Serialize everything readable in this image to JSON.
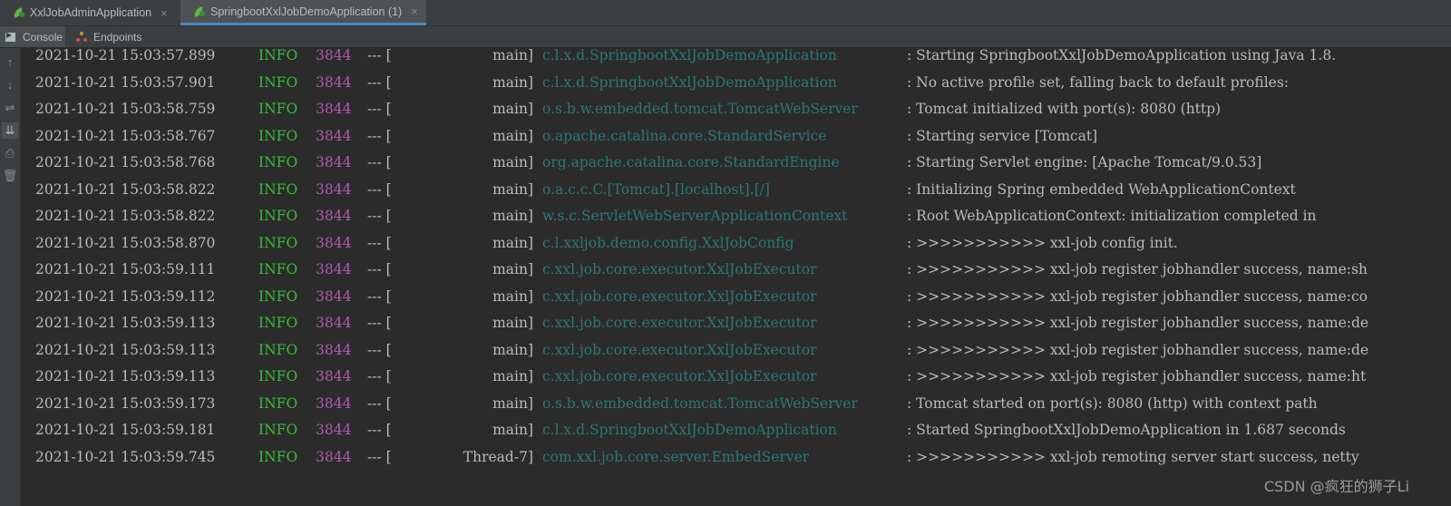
{
  "run_tabs": [
    {
      "label": "XxlJobAdminApplication",
      "icon": "spring-boot-icon",
      "close": "×"
    },
    {
      "label": "SpringbootXxlJobDemoApplication (1)",
      "icon": "spring-boot-icon",
      "close": "×"
    }
  ],
  "sub_tabs": [
    {
      "label": "Console",
      "icon": "console-icon"
    },
    {
      "label": "Endpoints",
      "icon": "endpoints-icon"
    }
  ],
  "toolbar": [
    {
      "icon": "arrow-up-icon",
      "glyph": "↑"
    },
    {
      "icon": "arrow-down-icon",
      "glyph": "↓"
    },
    {
      "icon": "soft-wrap-icon",
      "glyph": "⇌"
    },
    {
      "icon": "scroll-to-end-icon",
      "glyph": "⇊"
    },
    {
      "icon": "print-icon",
      "glyph": "⎙"
    },
    {
      "icon": "trash-icon",
      "glyph": "🗑"
    }
  ],
  "log_lines": [
    {
      "date": "2021-10-21 15:03:57.899",
      "level": "INFO",
      "pid": "3844",
      "sep": "--- [",
      "thread": "main]",
      "logger": "c.l.x.d.SpringbootXxlJobDemoApplication",
      "message": ": Starting SpringbootXxlJobDemoApplication using Java 1.8."
    },
    {
      "date": "2021-10-21 15:03:57.901",
      "level": "INFO",
      "pid": "3844",
      "sep": "--- [",
      "thread": "main]",
      "logger": "c.l.x.d.SpringbootXxlJobDemoApplication",
      "message": ": No active profile set, falling back to default profiles:"
    },
    {
      "date": "2021-10-21 15:03:58.759",
      "level": "INFO",
      "pid": "3844",
      "sep": "--- [",
      "thread": "main]",
      "logger": "o.s.b.w.embedded.tomcat.TomcatWebServer",
      "message": ": Tomcat initialized with port(s): 8080 (http)"
    },
    {
      "date": "2021-10-21 15:03:58.767",
      "level": "INFO",
      "pid": "3844",
      "sep": "--- [",
      "thread": "main]",
      "logger": "o.apache.catalina.core.StandardService",
      "message": ": Starting service [Tomcat]"
    },
    {
      "date": "2021-10-21 15:03:58.768",
      "level": "INFO",
      "pid": "3844",
      "sep": "--- [",
      "thread": "main]",
      "logger": "org.apache.catalina.core.StandardEngine",
      "message": ": Starting Servlet engine: [Apache Tomcat/9.0.53]"
    },
    {
      "date": "2021-10-21 15:03:58.822",
      "level": "INFO",
      "pid": "3844",
      "sep": "--- [",
      "thread": "main]",
      "logger": "o.a.c.c.C.[Tomcat].[localhost].[/]",
      "message": ": Initializing Spring embedded WebApplicationContext"
    },
    {
      "date": "2021-10-21 15:03:58.822",
      "level": "INFO",
      "pid": "3844",
      "sep": "--- [",
      "thread": "main]",
      "logger": "w.s.c.ServletWebServerApplicationContext",
      "message": ": Root WebApplicationContext: initialization completed in"
    },
    {
      "date": "2021-10-21 15:03:58.870",
      "level": "INFO",
      "pid": "3844",
      "sep": "--- [",
      "thread": "main]",
      "logger": "c.l.xxljob.demo.config.XxlJobConfig",
      "message": ": >>>>>>>>>>> xxl-job config init."
    },
    {
      "date": "2021-10-21 15:03:59.111",
      "level": "INFO",
      "pid": "3844",
      "sep": "--- [",
      "thread": "main]",
      "logger": "c.xxl.job.core.executor.XxlJobExecutor",
      "message": ": >>>>>>>>>>> xxl-job register jobhandler success, name:sh"
    },
    {
      "date": "2021-10-21 15:03:59.112",
      "level": "INFO",
      "pid": "3844",
      "sep": "--- [",
      "thread": "main]",
      "logger": "c.xxl.job.core.executor.XxlJobExecutor",
      "message": ": >>>>>>>>>>> xxl-job register jobhandler success, name:co"
    },
    {
      "date": "2021-10-21 15:03:59.113",
      "level": "INFO",
      "pid": "3844",
      "sep": "--- [",
      "thread": "main]",
      "logger": "c.xxl.job.core.executor.XxlJobExecutor",
      "message": ": >>>>>>>>>>> xxl-job register jobhandler success, name:de"
    },
    {
      "date": "2021-10-21 15:03:59.113",
      "level": "INFO",
      "pid": "3844",
      "sep": "--- [",
      "thread": "main]",
      "logger": "c.xxl.job.core.executor.XxlJobExecutor",
      "message": ": >>>>>>>>>>> xxl-job register jobhandler success, name:de"
    },
    {
      "date": "2021-10-21 15:03:59.113",
      "level": "INFO",
      "pid": "3844",
      "sep": "--- [",
      "thread": "main]",
      "logger": "c.xxl.job.core.executor.XxlJobExecutor",
      "message": ": >>>>>>>>>>> xxl-job register jobhandler success, name:ht"
    },
    {
      "date": "2021-10-21 15:03:59.173",
      "level": "INFO",
      "pid": "3844",
      "sep": "--- [",
      "thread": "main]",
      "logger": "o.s.b.w.embedded.tomcat.TomcatWebServer",
      "message": ": Tomcat started on port(s): 8080 (http) with context path"
    },
    {
      "date": "2021-10-21 15:03:59.181",
      "level": "INFO",
      "pid": "3844",
      "sep": "--- [",
      "thread": "main]",
      "logger": "c.l.x.d.SpringbootXxlJobDemoApplication",
      "message": ": Started SpringbootXxlJobDemoApplication in 1.687 seconds"
    },
    {
      "date": "2021-10-21 15:03:59.745",
      "level": "INFO",
      "pid": "3844",
      "sep": "--- [",
      "thread": "Thread-7]",
      "logger": "com.xxl.job.core.server.EmbedServer",
      "message": ": >>>>>>>>>>> xxl-job remoting server start success, netty"
    }
  ],
  "watermark": "CSDN @疯狂的狮子Li",
  "colors": {
    "background": "#2b2b2b",
    "info_level": "#3dbb3d",
    "pid": "#b45ab4",
    "logger": "#2e7876",
    "text": "#bbbbbb",
    "active_tab_underline": "#4a88c7"
  }
}
